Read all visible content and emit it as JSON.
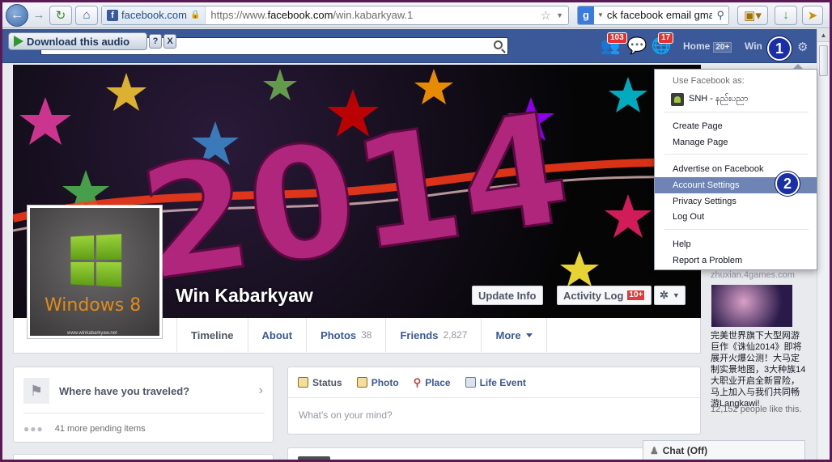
{
  "browser": {
    "site_identity": "facebook.com",
    "url_prefix": "https://www.",
    "url_host": "facebook.com",
    "url_path": "/win.kabarkyaw.1",
    "search_text": "ck facebook email gmail"
  },
  "download_bar": {
    "label": "Download this audio",
    "help": "?",
    "close": "X"
  },
  "fb_header": {
    "friend_requests_count": "103",
    "notifications_count": "17",
    "home_label": "Home",
    "home_count": "20+",
    "user_label": "Win"
  },
  "callouts": {
    "one": "1",
    "two": "2"
  },
  "settings_menu": {
    "use_as_heading": "Use Facebook as:",
    "page_name": "SNH - နည်းပညာ",
    "create_page": "Create Page",
    "manage_page": "Manage Page",
    "advertise": "Advertise on Facebook",
    "account_settings": "Account Settings",
    "privacy_settings": "Privacy Settings",
    "log_out": "Log Out",
    "help": "Help",
    "report_problem": "Report a Problem"
  },
  "cover": {
    "year_text": "2014"
  },
  "profile": {
    "name": "Win Kabarkyaw",
    "pic_caption": "Windows 8",
    "pic_url": "www.winkabarkyaw.net",
    "update_info": "Update Info",
    "activity_log": "Activity Log",
    "activity_count": "10+",
    "settings_glyph": "✲"
  },
  "tabs": [
    {
      "label": "Timeline",
      "count": ""
    },
    {
      "label": "About",
      "count": ""
    },
    {
      "label": "Photos",
      "count": "38"
    },
    {
      "label": "Friends",
      "count": "2,827"
    },
    {
      "label": "More",
      "count": ""
    }
  ],
  "left_card": {
    "travel_prompt": "Where have you traveled?",
    "pending": "41 more pending items"
  },
  "composer": {
    "status": "Status",
    "photo": "Photo",
    "place": "Place",
    "life_event": "Life Event",
    "placeholder": "What's on your mind?"
  },
  "ad": {
    "domain": "zhuxian.4games.com",
    "text": "完美世界旗下大型网游巨作《诛仙2014》即将展开火爆公测！大马定制实景地图，3大种族14大职业开启全新冒险，马上加入与我们共同畅游Langkawi!",
    "likes": "12,152 people like this."
  },
  "chat": {
    "label": "Chat (Off)"
  },
  "colors": {
    "fb_blue": "#3b5998",
    "menu_highlight": "#6d84b4",
    "callout": "#1a2ea8",
    "badge_red": "#e53030"
  }
}
